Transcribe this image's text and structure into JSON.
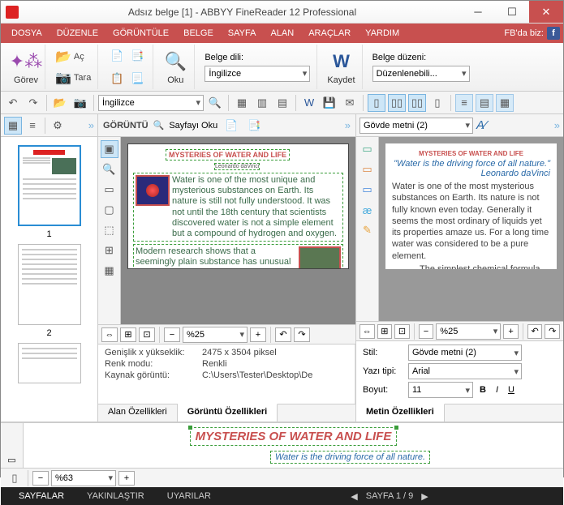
{
  "titlebar": {
    "title": "Adsız belge [1] - ABBYY FineReader 12 Professional"
  },
  "winbtns": {
    "min": "─",
    "max": "☐",
    "close": "✕"
  },
  "menu": {
    "file": "DOSYA",
    "edit": "DÜZENLE",
    "view": "GÖRÜNTÜLE",
    "doc": "BELGE",
    "page": "SAYFA",
    "area": "ALAN",
    "tools": "ARAÇLAR",
    "help": "YARDIM",
    "fb": "FB'da biz:",
    "f": "f"
  },
  "ribbon": {
    "task": "Görev",
    "open": "Aç",
    "scan": "Tara",
    "read": "Oku",
    "doclang": "Belge dili:",
    "lang": "İngilizce",
    "save": "Kaydet",
    "layout": "Belge düzeni:",
    "layoutval": "Düzenlenebili..."
  },
  "tb2": {
    "lang": "İngilizce"
  },
  "left": {
    "p1": "1",
    "p2": "2"
  },
  "mid": {
    "title": "GÖRÜNTÜ",
    "readpage": "Sayfayı Oku",
    "ptitle": "MYSTERIES OF WATER AND LIFE",
    "pauth": "Leonardo daVinci",
    "zoom": "%25",
    "props": {
      "dim_l": "Genişlik x yükseklik:",
      "dim_v": "2475 x 3504 piksel",
      "color_l": "Renk modu:",
      "color_v": "Renkli",
      "src_l": "Kaynak görüntü:",
      "src_v": "C:\\Users\\Tester\\Desktop\\De"
    },
    "tabs": {
      "area": "Alan Özellikleri",
      "image": "Görüntü Özellikleri"
    }
  },
  "right": {
    "style": "Gövde metni (2)",
    "rtitle": "MYSTERIES OF WATER AND LIFE",
    "rauth": "\"Water is the driving force of all nature.\" Leonardo daVinci",
    "zoom": "%25",
    "props": {
      "style_l": "Stil:",
      "style_v": "Gövde metni (2)",
      "font_l": "Yazı tipi:",
      "font_v": "Arial",
      "size_l": "Boyut:",
      "size_v": "11",
      "b": "B",
      "i": "I",
      "u": "U"
    },
    "tab": "Metin Özellikleri"
  },
  "bottom": {
    "title": "MYSTERIES OF WATER AND LIFE",
    "subtitle": "Water is the driving force of all nature.",
    "zoom": "%63"
  },
  "status": {
    "pages": "SAYFALAR",
    "zoom": "YAKINLAŞTIR",
    "warn": "UYARILAR",
    "pg": "SAYFA 1 / 9"
  }
}
